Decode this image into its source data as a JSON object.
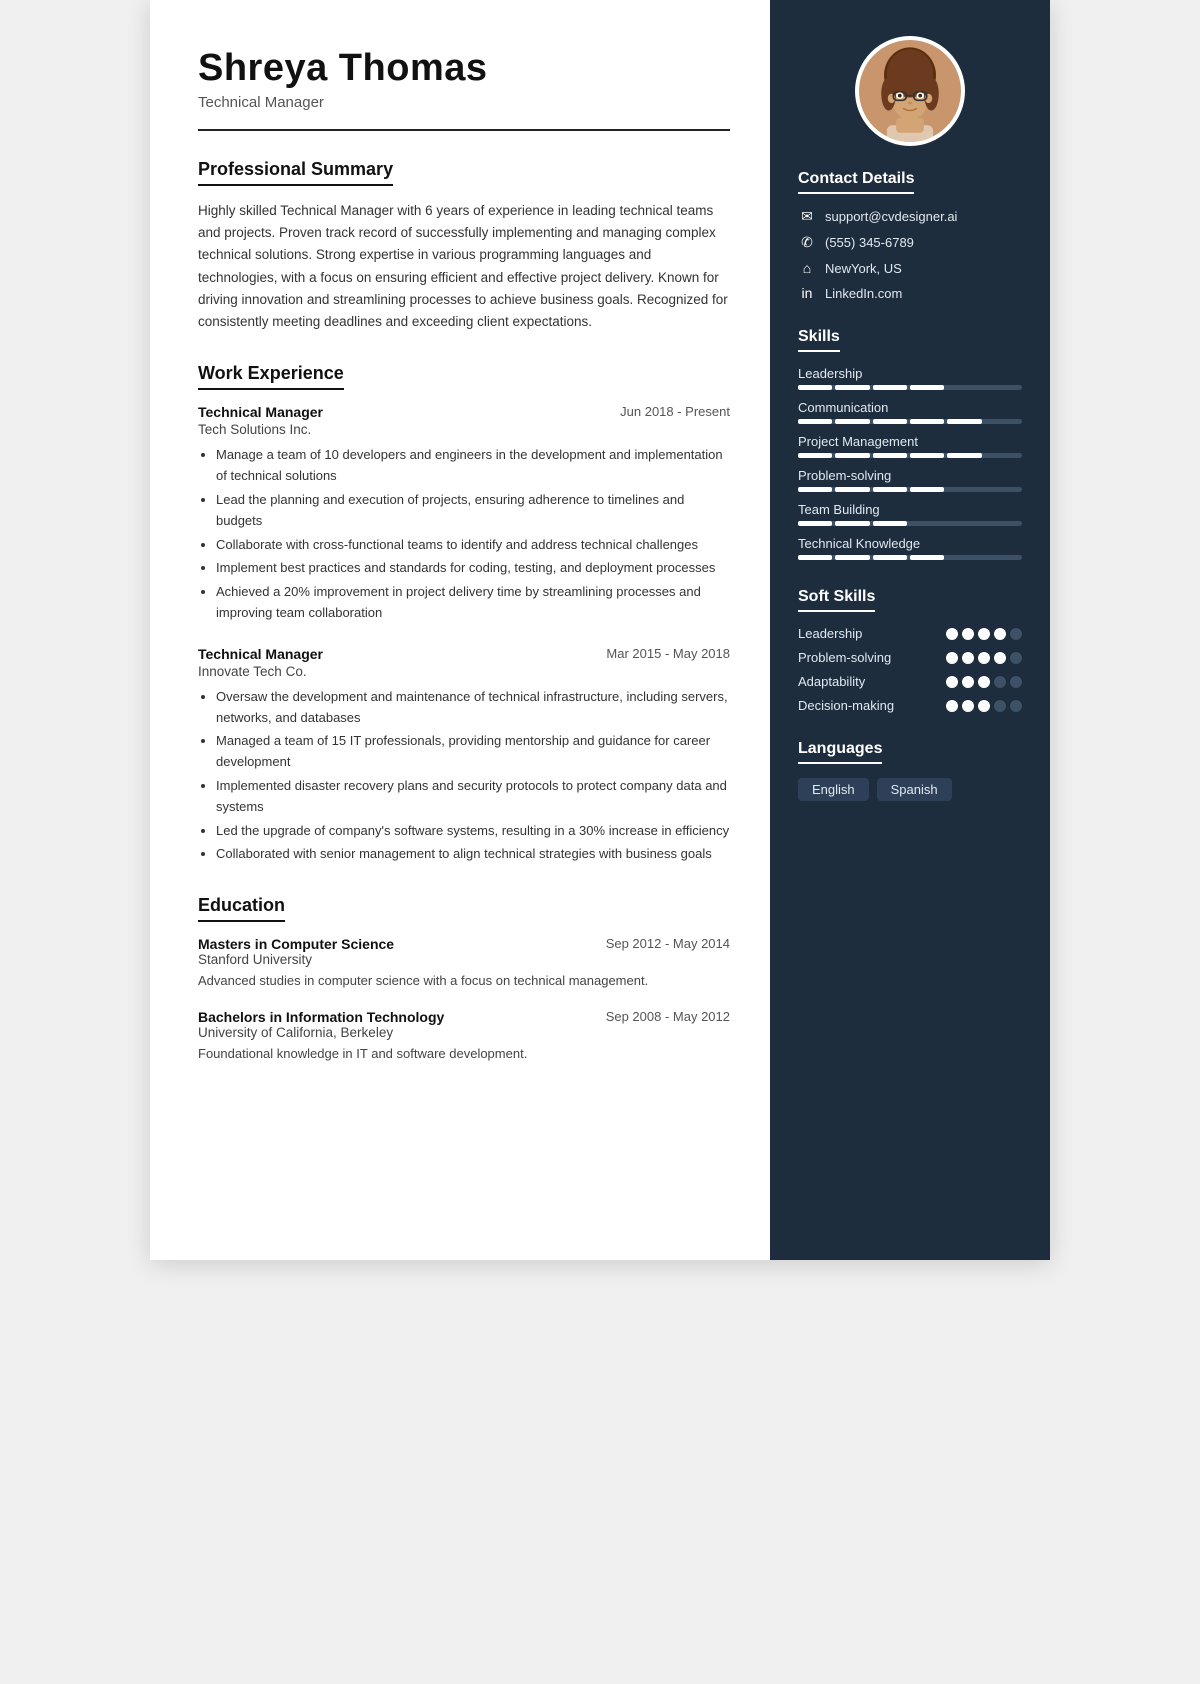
{
  "header": {
    "name": "Shreya Thomas",
    "title": "Technical Manager"
  },
  "summary": {
    "section_title": "Professional Summary",
    "text": "Highly skilled Technical Manager with 6 years of experience in leading technical teams and projects. Proven track record of successfully implementing and managing complex technical solutions. Strong expertise in various programming languages and technologies, with a focus on ensuring efficient and effective project delivery. Known for driving innovation and streamlining processes to achieve business goals. Recognized for consistently meeting deadlines and exceeding client expectations."
  },
  "work_experience": {
    "section_title": "Work Experience",
    "jobs": [
      {
        "title": "Technical Manager",
        "company": "Tech Solutions Inc.",
        "dates": "Jun 2018 - Present",
        "bullets": [
          "Manage a team of 10 developers and engineers in the development and implementation of technical solutions",
          "Lead the planning and execution of projects, ensuring adherence to timelines and budgets",
          "Collaborate with cross-functional teams to identify and address technical challenges",
          "Implement best practices and standards for coding, testing, and deployment processes",
          "Achieved a 20% improvement in project delivery time by streamlining processes and improving team collaboration"
        ]
      },
      {
        "title": "Technical Manager",
        "company": "Innovate Tech Co.",
        "dates": "Mar 2015 - May 2018",
        "bullets": [
          "Oversaw the development and maintenance of technical infrastructure, including servers, networks, and databases",
          "Managed a team of 15 IT professionals, providing mentorship and guidance for career development",
          "Implemented disaster recovery plans and security protocols to protect company data and systems",
          "Led the upgrade of company's software systems, resulting in a 30% increase in efficiency",
          "Collaborated with senior management to align technical strategies with business goals"
        ]
      }
    ]
  },
  "education": {
    "section_title": "Education",
    "items": [
      {
        "degree": "Masters in Computer Science",
        "school": "Stanford University",
        "dates": "Sep 2012 - May 2014",
        "description": "Advanced studies in computer science with a focus on technical management."
      },
      {
        "degree": "Bachelors in Information Technology",
        "school": "University of California, Berkeley",
        "dates": "Sep 2008 - May 2012",
        "description": "Foundational knowledge in IT and software development."
      }
    ]
  },
  "contact": {
    "section_title": "Contact Details",
    "items": [
      {
        "icon": "✉",
        "value": "support@cvdesigner.ai"
      },
      {
        "icon": "✆",
        "value": "(555) 345-6789"
      },
      {
        "icon": "⌂",
        "value": "NewYork, US"
      },
      {
        "icon": "in",
        "value": "LinkedIn.com"
      }
    ]
  },
  "skills": {
    "section_title": "Skills",
    "items": [
      {
        "name": "Leadership",
        "filled": 4,
        "total": 6
      },
      {
        "name": "Communication",
        "filled": 5,
        "total": 6
      },
      {
        "name": "Project Management",
        "filled": 5,
        "total": 6
      },
      {
        "name": "Problem-solving",
        "filled": 4,
        "total": 6
      },
      {
        "name": "Team Building",
        "filled": 3,
        "total": 6
      },
      {
        "name": "Technical Knowledge",
        "filled": 4,
        "total": 6
      }
    ]
  },
  "soft_skills": {
    "section_title": "Soft Skills",
    "items": [
      {
        "name": "Leadership",
        "filled": 4,
        "total": 5
      },
      {
        "name": "Problem-solving",
        "filled": 4,
        "total": 5
      },
      {
        "name": "Adaptability",
        "filled": 3,
        "total": 5
      },
      {
        "name": "Decision-making",
        "filled": 3,
        "total": 5
      }
    ]
  },
  "languages": {
    "section_title": "Languages",
    "items": [
      "English",
      "Spanish"
    ]
  }
}
